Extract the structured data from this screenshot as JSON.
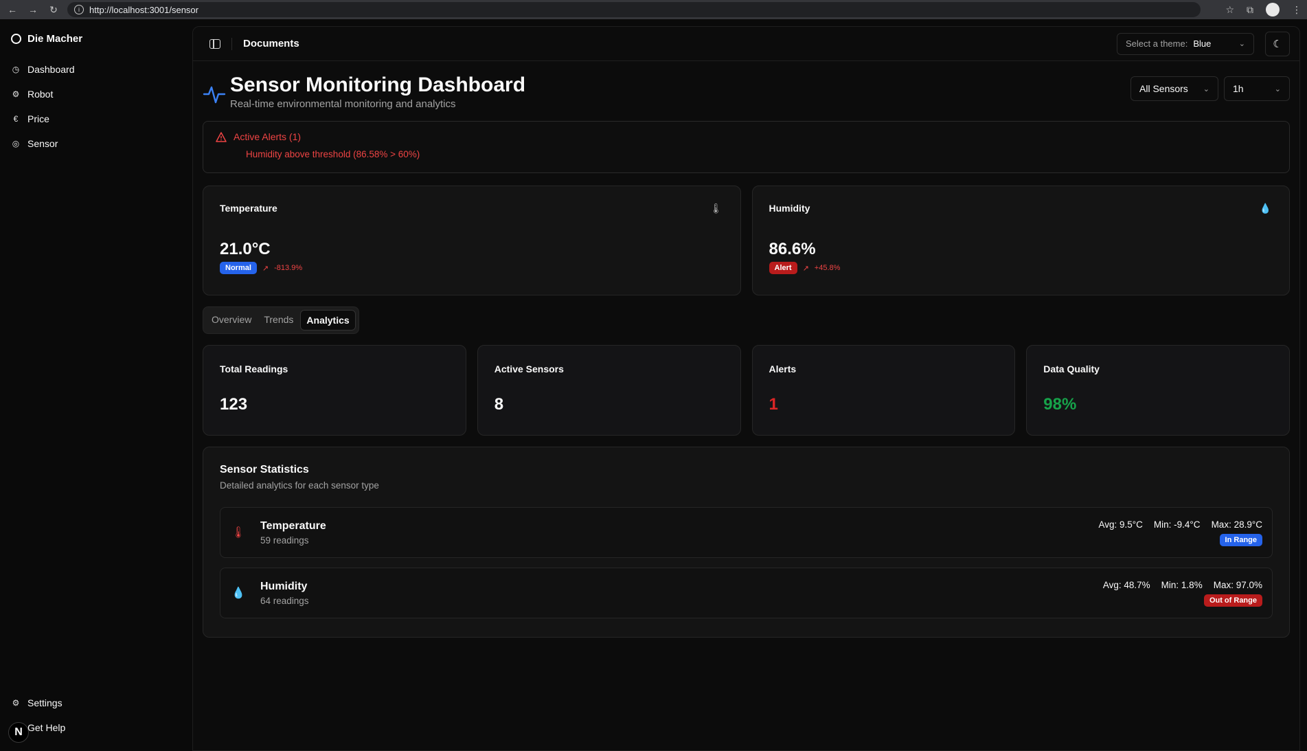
{
  "browser": {
    "url": "http://localhost:3001/sensor"
  },
  "sidebar": {
    "brand": "Die Macher",
    "items": [
      {
        "label": "Dashboard",
        "icon": "dashboard-icon"
      },
      {
        "label": "Robot",
        "icon": "robot-icon"
      },
      {
        "label": "Price",
        "icon": "euro-icon"
      },
      {
        "label": "Sensor",
        "icon": "sensor-icon"
      }
    ],
    "bottom": [
      {
        "label": "Settings",
        "icon": "gear-icon"
      },
      {
        "label": "Get Help",
        "icon": "help-icon"
      }
    ],
    "badge": "N"
  },
  "topbar": {
    "title": "Documents",
    "theme_label": "Select a theme:",
    "theme_value": "Blue"
  },
  "page": {
    "title": "Sensor Monitoring Dashboard",
    "subtitle": "Real-time environmental monitoring and analytics",
    "filter_sensors": "All Sensors",
    "filter_range": "1h"
  },
  "alerts": {
    "title": "Active Alerts (1)",
    "message": "Humidity above threshold (86.58% > 60%)"
  },
  "metrics": [
    {
      "label": "Temperature",
      "value": "21.0°C",
      "status": "Normal",
      "trend": "-813.9%",
      "status_color": "#2563eb"
    },
    {
      "label": "Humidity",
      "value": "86.6%",
      "status": "Alert",
      "trend": "+45.8%",
      "status_color": "#b91c1c"
    }
  ],
  "tabs": [
    "Overview",
    "Trends",
    "Analytics"
  ],
  "active_tab": "Analytics",
  "stats": [
    {
      "label": "Total Readings",
      "value": "123",
      "color": "#fafafa"
    },
    {
      "label": "Active Sensors",
      "value": "8",
      "color": "#fafafa"
    },
    {
      "label": "Alerts",
      "value": "1",
      "color": "#dc2626"
    },
    {
      "label": "Data Quality",
      "value": "98%",
      "color": "#16a34a"
    }
  ],
  "sensor_statistics": {
    "title": "Sensor Statistics",
    "subtitle": "Detailed analytics for each sensor type",
    "rows": [
      {
        "name": "Temperature",
        "readings": "59 readings",
        "avg": "Avg: 9.5°C",
        "min": "Min: -9.4°C",
        "max": "Max: 28.9°C",
        "status": "In Range",
        "status_color": "#2563eb"
      },
      {
        "name": "Humidity",
        "readings": "64 readings",
        "avg": "Avg: 48.7%",
        "min": "Min: 1.8%",
        "max": "Max: 97.0%",
        "status": "Out of Range",
        "status_color": "#b91c1c"
      }
    ]
  }
}
